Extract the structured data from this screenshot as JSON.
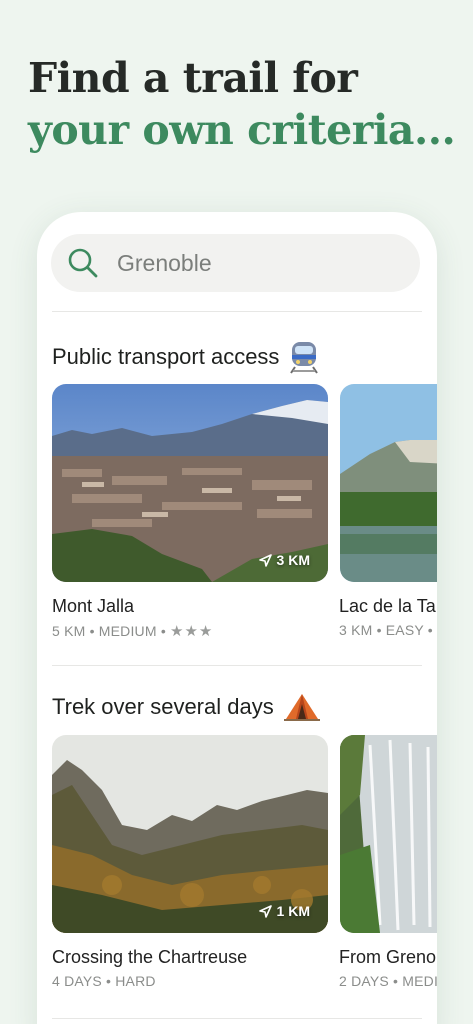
{
  "headline": {
    "line1": "Find a trail for",
    "line2": "your own criteria..."
  },
  "search": {
    "placeholder": "Grenoble"
  },
  "sections": [
    {
      "title": "Public transport access",
      "emoji_icon": "train-icon",
      "cards": [
        {
          "title": "Mont Jalla",
          "meta": "5 KM • MEDIUM •",
          "stars": "★★★",
          "distance": "3 KM"
        },
        {
          "title": "Lac de la Ta",
          "meta": "3 KM • EASY •"
        }
      ]
    },
    {
      "title": "Trek over several days",
      "emoji_icon": "tent-icon",
      "cards": [
        {
          "title": "Crossing the Chartreuse",
          "meta": "4 DAYS • HARD",
          "distance": "1 KM"
        },
        {
          "title": "From Greno",
          "meta": "2 DAYS • MEDI"
        }
      ]
    }
  ],
  "colors": {
    "accent": "#3d8a5f",
    "background": "#eef5ef",
    "text": "#262a27"
  }
}
